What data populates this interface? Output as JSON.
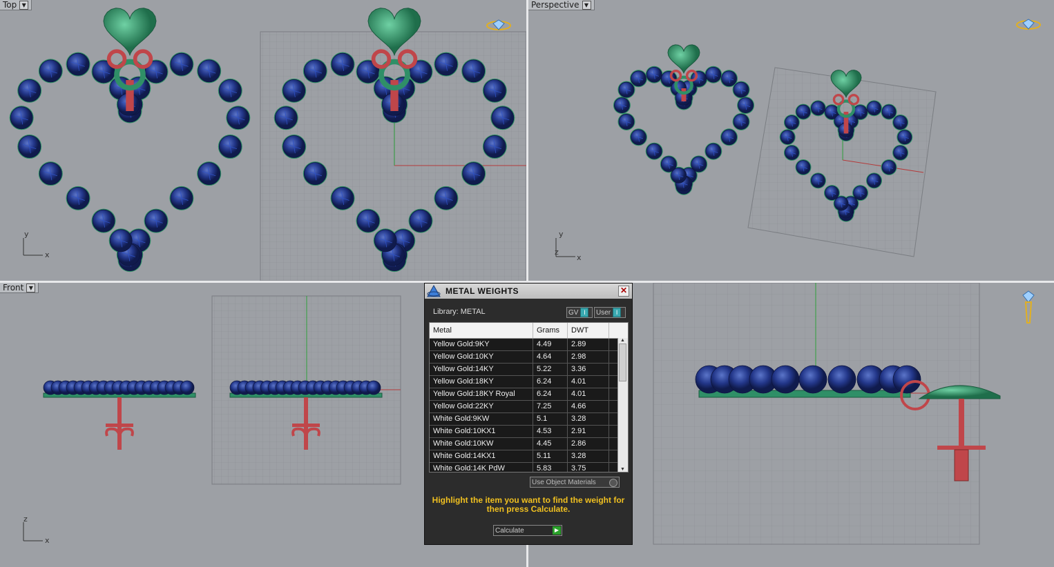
{
  "viewports": {
    "top": {
      "label": "Top"
    },
    "perspective": {
      "label": "Perspective"
    },
    "front": {
      "label": "Front"
    }
  },
  "axes": {
    "x": "x",
    "y": "y",
    "z": "z"
  },
  "dialog": {
    "title": "METAL WEIGHTS",
    "close": "✕",
    "library_label": "Library: METAL",
    "gv_label": "GV",
    "user_label": "User",
    "toggle_mark": "I",
    "columns": [
      "Metal",
      "Grams",
      "DWT"
    ],
    "rows": [
      {
        "metal": "Yellow Gold:9KY",
        "grams": "4.49",
        "dwt": "2.89"
      },
      {
        "metal": "Yellow Gold:10KY",
        "grams": "4.64",
        "dwt": "2.98"
      },
      {
        "metal": "Yellow Gold:14KY",
        "grams": "5.22",
        "dwt": "3.36"
      },
      {
        "metal": "Yellow Gold:18KY",
        "grams": "6.24",
        "dwt": "4.01"
      },
      {
        "metal": "Yellow Gold:18KY Royal",
        "grams": "6.24",
        "dwt": "4.01"
      },
      {
        "metal": "Yellow Gold:22KY",
        "grams": "7.25",
        "dwt": "4.66"
      },
      {
        "metal": "White Gold:9KW",
        "grams": "5.1",
        "dwt": "3.28"
      },
      {
        "metal": "White Gold:10KX1",
        "grams": "4.53",
        "dwt": "2.91"
      },
      {
        "metal": "White Gold:10KW",
        "grams": "4.45",
        "dwt": "2.86"
      },
      {
        "metal": "White Gold:14KX1",
        "grams": "5.11",
        "dwt": "3.28"
      },
      {
        "metal": "White Gold:14K PdW",
        "grams": "5.83",
        "dwt": "3.75"
      }
    ],
    "use_object_materials": "Use Object Materials",
    "hint": "Highlight the item you want to find the weight for then press Calculate.",
    "calculate_label": "Calculate",
    "calculate_arrow": "▶"
  },
  "colors": {
    "viewport_bg": "#9da0a5",
    "gem_blue": "#23378a",
    "metal_green": "#2f8f67",
    "metal_red": "#c0464a",
    "highlight": "#f0c020"
  }
}
